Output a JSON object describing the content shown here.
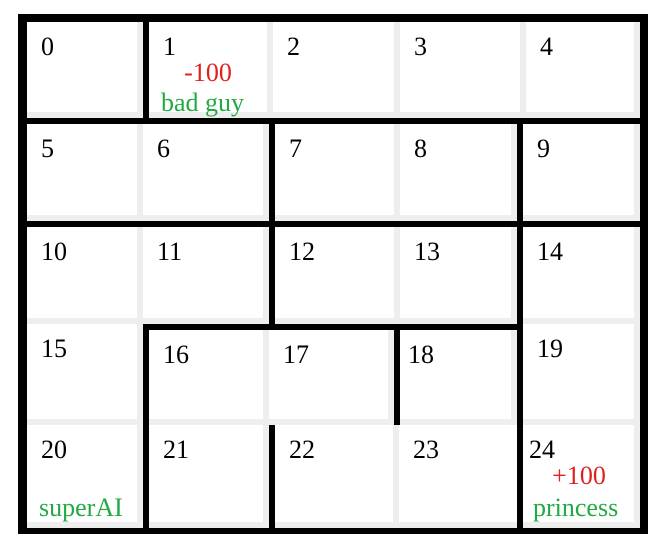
{
  "cells": [
    {
      "id": "0"
    },
    {
      "id": "1",
      "reward": "-100",
      "label": "bad guy"
    },
    {
      "id": "2"
    },
    {
      "id": "3"
    },
    {
      "id": "4"
    },
    {
      "id": "5"
    },
    {
      "id": "6"
    },
    {
      "id": "7"
    },
    {
      "id": "8"
    },
    {
      "id": "9"
    },
    {
      "id": "10"
    },
    {
      "id": "11"
    },
    {
      "id": "12"
    },
    {
      "id": "13"
    },
    {
      "id": "14"
    },
    {
      "id": "15"
    },
    {
      "id": "16"
    },
    {
      "id": "17"
    },
    {
      "id": "18"
    },
    {
      "id": "19"
    },
    {
      "id": "20",
      "label": "superAI"
    },
    {
      "id": "21"
    },
    {
      "id": "22"
    },
    {
      "id": "23"
    },
    {
      "id": "24",
      "reward": "+100",
      "label": "princess"
    }
  ],
  "colors": {
    "wall": "#000000",
    "cell": "#ffffff",
    "gridline": "#eeeeee",
    "reward": "#e02020",
    "label": "#22aa44"
  }
}
